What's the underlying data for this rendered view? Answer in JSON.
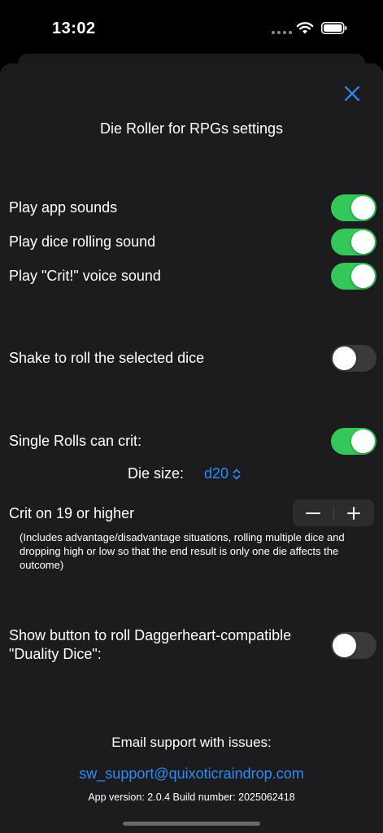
{
  "status_bar": {
    "time": "13:02"
  },
  "settings": {
    "title": "Die Roller for RPGs settings",
    "play_app_sounds": {
      "label": "Play app sounds",
      "on": true
    },
    "play_dice_rolling_sound": {
      "label": "Play dice rolling sound",
      "on": true
    },
    "play_crit_voice_sound": {
      "label": "Play \"Crit!\" voice sound",
      "on": true
    },
    "shake_to_roll": {
      "label": "Shake to roll the selected dice",
      "on": false
    },
    "single_rolls_can_crit": {
      "label": "Single Rolls can crit:",
      "on": true
    },
    "die_size": {
      "label": "Die size:",
      "value": "d20"
    },
    "crit_threshold": {
      "label": "Crit on 19 or higher"
    },
    "crit_note": "(Includes advantage/disadvantage situations, rolling multiple dice and dropping high or low so that the end result is only one die affects the outcome)",
    "duality_dice": {
      "label_line1": "Show button to roll Daggerheart-compatible",
      "label_line2": "\"Duality Dice\":",
      "on": false
    }
  },
  "footer": {
    "email_title": "Email support with issues:",
    "email": "sw_support@quixoticraindrop.com",
    "version": "App version: 2.0.4   Build number: 2025062418"
  },
  "colors": {
    "accent": "#2f8cf6",
    "toggle_on": "#34c759",
    "toggle_off": "#3a3a3c",
    "sheet": "#1c1c1e"
  },
  "icons": [
    "close-icon",
    "chevron-up-down-icon",
    "minus-icon",
    "plus-icon",
    "wifi-icon",
    "battery-icon"
  ]
}
